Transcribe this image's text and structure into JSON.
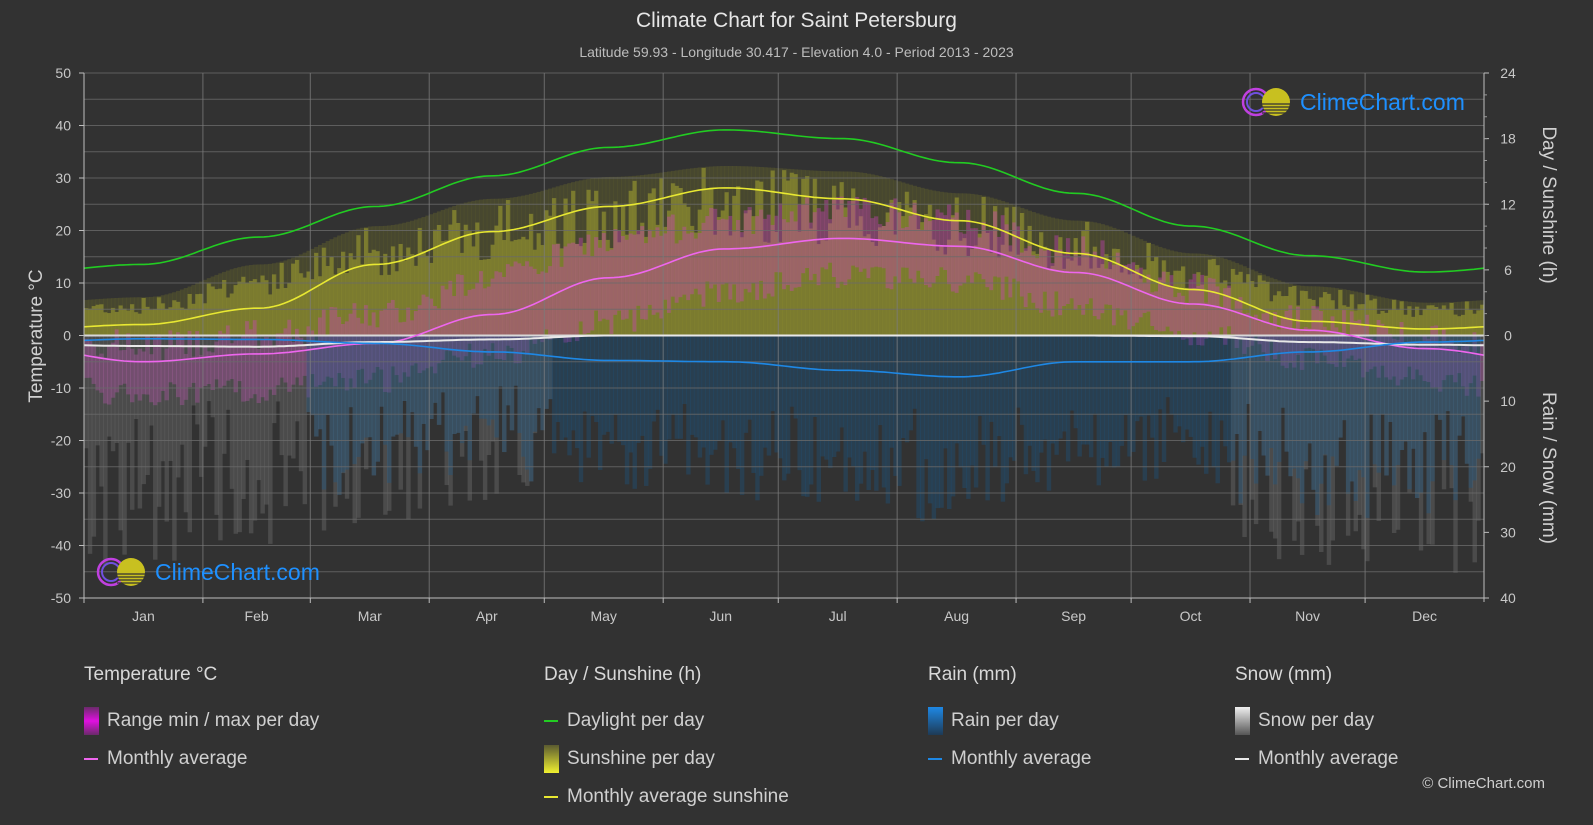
{
  "header": {
    "title": "Climate Chart for Saint Petersburg",
    "subtitle": "Latitude 59.93 - Longitude 30.417 - Elevation 4.0 - Period 2013 - 2023"
  },
  "axes": {
    "left_title": "Temperature °C",
    "right_top_title": "Day / Sunshine (h)",
    "right_bottom_title": "Rain / Snow (mm)"
  },
  "logo": {
    "text": "ClimeChart.com"
  },
  "legend": {
    "temperature": {
      "heading": "Temperature °C",
      "items": [
        "Range min / max per day",
        "Monthly average"
      ]
    },
    "sunshine": {
      "heading": "Day / Sunshine (h)",
      "items": [
        "Daylight per day",
        "Sunshine per day",
        "Monthly average sunshine"
      ]
    },
    "rain": {
      "heading": "Rain (mm)",
      "items": [
        "Rain per day",
        "Monthly average"
      ]
    },
    "snow": {
      "heading": "Snow (mm)",
      "items": [
        "Snow per day",
        "Monthly average"
      ]
    }
  },
  "copyright": "© ClimeChart.com",
  "colors": {
    "background": "#323232",
    "daylight": "#22cc22",
    "sunshine_avg": "#e8e832",
    "temp_avg": "#ee66ee",
    "rain_avg": "#1e88e5",
    "snow_avg": "#e8e8e8",
    "temp_range": "#e020e0",
    "sunshine_bar": "#a0a030",
    "rain_bar": "#1a6aa8",
    "snow_bar": "#888888",
    "logo_text": "#1e90ff"
  },
  "chart_data": {
    "type": "line",
    "title": "Climate Chart for Saint Petersburg",
    "categories": [
      "Jan",
      "Feb",
      "Mar",
      "Apr",
      "May",
      "Jun",
      "Jul",
      "Aug",
      "Sep",
      "Oct",
      "Nov",
      "Dec"
    ],
    "left_axis": {
      "label": "Temperature °C",
      "range": [
        -50,
        50
      ],
      "ticks": [
        50,
        40,
        30,
        20,
        10,
        0,
        -10,
        -20,
        -30,
        -40,
        -50
      ]
    },
    "right_axis_top": {
      "label": "Day / Sunshine (h)",
      "range": [
        0,
        24
      ],
      "ticks": [
        24,
        18,
        12,
        6,
        0
      ]
    },
    "right_axis_bottom": {
      "label": "Rain / Snow (mm)",
      "range": [
        0,
        40
      ],
      "ticks": [
        0,
        10,
        20,
        30,
        40
      ]
    },
    "grid": true,
    "legend_position": "bottom",
    "series": [
      {
        "name": "Daylight per day",
        "axis": "sunshine_h",
        "values": [
          6.5,
          9.0,
          11.8,
          14.6,
          17.2,
          18.8,
          18.0,
          15.8,
          13.0,
          10.0,
          7.3,
          5.8
        ]
      },
      {
        "name": "Monthly average sunshine",
        "axis": "sunshine_h",
        "values": [
          1.0,
          2.5,
          6.5,
          9.5,
          11.8,
          13.5,
          12.5,
          10.5,
          7.5,
          4.2,
          1.3,
          0.6
        ]
      },
      {
        "name": "Temperature monthly average",
        "axis": "temperature_c",
        "values": [
          -5.0,
          -3.5,
          -1.5,
          4.0,
          11.0,
          16.5,
          18.5,
          17.0,
          12.0,
          6.0,
          1.0,
          -2.5
        ]
      },
      {
        "name": "Rain monthly average",
        "axis": "precip_mm",
        "values": [
          0.5,
          0.6,
          1.2,
          2.5,
          3.8,
          4.0,
          5.3,
          6.3,
          4.0,
          4.0,
          2.5,
          1.0
        ]
      },
      {
        "name": "Snow monthly average",
        "axis": "precip_mm",
        "values": [
          1.6,
          1.7,
          1.0,
          0.6,
          0.0,
          0.0,
          0.0,
          0.0,
          0.0,
          0.1,
          1.0,
          1.4
        ]
      }
    ],
    "daily_ranges": {
      "temp_max_monthly_approx": [
        -2,
        0,
        4,
        11,
        18,
        22,
        24,
        22,
        16,
        9,
        3,
        0
      ],
      "temp_min_monthly_approx": [
        -9,
        -8,
        -6,
        -1,
        5,
        11,
        14,
        13,
        8,
        3,
        -2,
        -6
      ],
      "sunshine_upper_envelope_h": [
        3.5,
        6.5,
        10,
        12.5,
        14.5,
        15.5,
        15.0,
        13.0,
        10.5,
        7.5,
        4.5,
        3.0
      ],
      "precip_daily_extreme_mm": [
        35,
        32,
        30,
        25,
        30,
        32,
        35,
        38,
        30,
        30,
        35,
        38
      ]
    }
  }
}
